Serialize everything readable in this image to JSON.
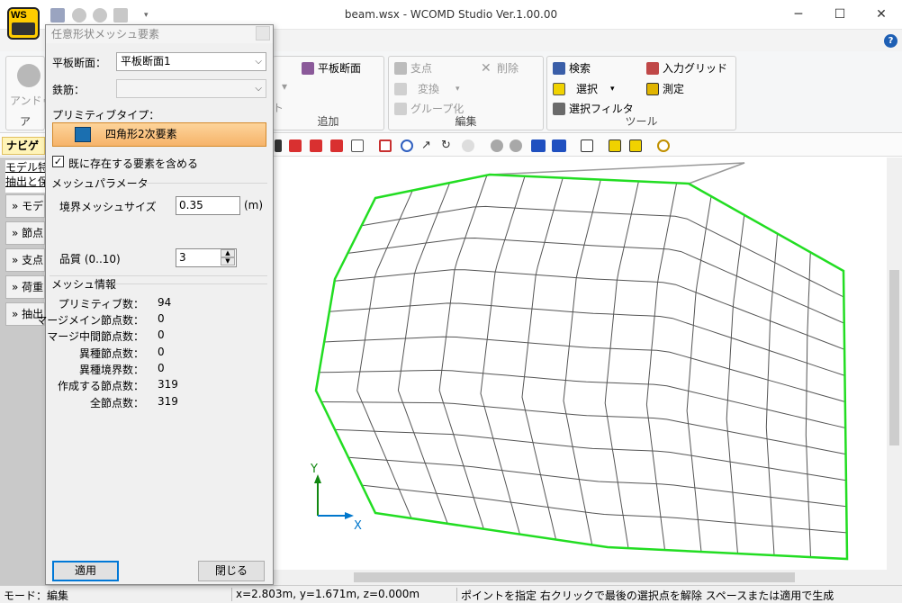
{
  "window": {
    "title": "beam.wsx - WCOMD Studio Ver.1.00.00",
    "logo_text": "WS",
    "min_glyph": "─",
    "max_glyph": "☐",
    "close_glyph": "✕",
    "qat_dropdown_glyph": "▾",
    "help_glyph": "?"
  },
  "ribbon": {
    "anduo_label": "アンドゥ",
    "group1_label": "ア",
    "add_label": "平板断面",
    "add_partial": "ト",
    "add_group_label": "追加",
    "edit_items": [
      "支点",
      "削除",
      "変換",
      "グループ化"
    ],
    "edit_group_label": "編集",
    "tools_items": [
      "検索",
      "入力グリッド",
      "選択",
      "測定",
      "選択フィルタ"
    ],
    "tools_group_label": "ツール",
    "dropdown_glyph": "▾"
  },
  "nav": {
    "header": "ナビゲ",
    "links": [
      "モデル特",
      "抽出と保"
    ],
    "items": [
      "モデ",
      "節点",
      "支点",
      "荷重",
      "抽出"
    ],
    "item_glyph": "»"
  },
  "dialog": {
    "title": "任意形状メッシュ要素",
    "section_label": "平板断面：",
    "section_value": "平板断面1",
    "rebar_label": "鉄筋：",
    "rebar_value": "",
    "primitive_label": "プリミティブタイプ：",
    "primitive_value": "四角形2次要素",
    "include_label": "既に存在する要素を含める",
    "include_checked": "✓",
    "mesh_params_title": "メッシュパラメータ",
    "boundary_label": "境界メッシュサイズ",
    "boundary_value": "0.35",
    "boundary_unit": "(m)",
    "quality_label": "品質 (0..10)",
    "quality_value": "3",
    "mesh_info_title": "メッシュ情報",
    "info": [
      {
        "label": "プリミティブ数：",
        "value": "94"
      },
      {
        "label": "マージメイン節点数：",
        "value": "0"
      },
      {
        "label": "マージ中間節点数：",
        "value": "0"
      },
      {
        "label": "異種節点数：",
        "value": "0"
      },
      {
        "label": "異種境界数：",
        "value": "0"
      },
      {
        "label": "作成する節点数：",
        "value": "319"
      },
      {
        "label": "全節点数：",
        "value": "319"
      }
    ],
    "apply_label": "適用",
    "close_label": "閉じる",
    "dropdown_glyph": "⌵"
  },
  "canvas": {
    "axis_y": "Y",
    "axis_x": "X",
    "boundary_color": "#22dd22",
    "mesh_color": "#555555",
    "axis_color": "#0077cc",
    "axis_y_color": "#118811"
  },
  "status": {
    "mode": "モード：編集",
    "coords": "x=2.803m, y=1.671m, z=0.000m",
    "hint": "ポイントを指定 右クリックで最後の選択点を解除 スペースまたは適用で生成"
  }
}
